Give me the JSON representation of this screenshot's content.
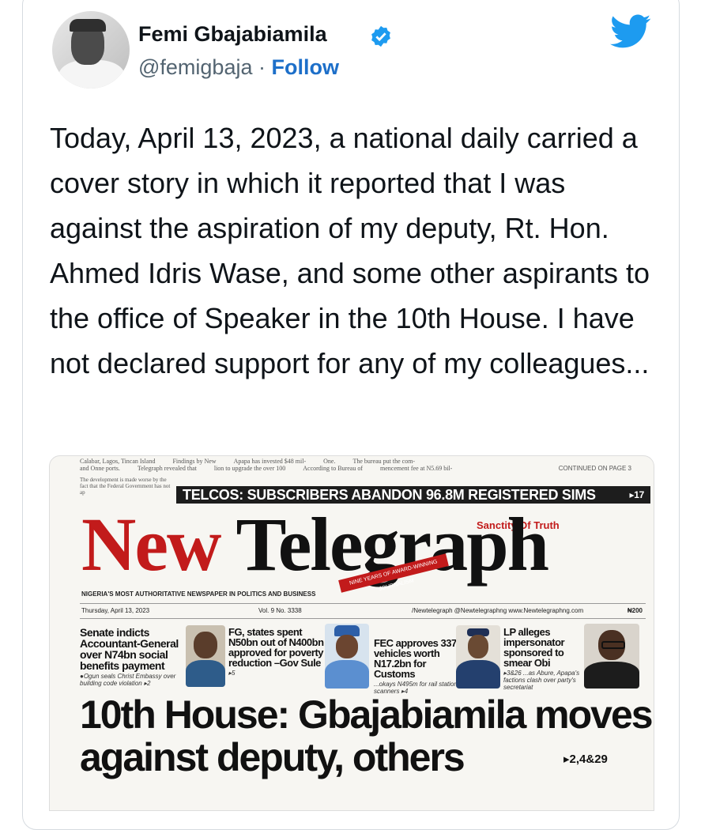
{
  "author": {
    "name": "Femi Gbajabiamila",
    "handle": "@femigbaja",
    "separator": "·",
    "follow_label": "Follow",
    "accent": "#1d9bf0"
  },
  "icons": [
    "verified-badge-icon",
    "twitter-bird-icon"
  ],
  "tweet": {
    "text": "Today, April 13, 2023, a national daily carried a cover story in which it reported that I was against the aspiration of my deputy, Rt. Hon. Ahmed Idris Wase, and some other aspirants to the office of Speaker in the 10th House.  I have not declared support for any of my colleagues..."
  },
  "newspaper": {
    "top_strip": "TELCOS: SUBSCRIBERS ABANDON 96.8M REGISTERED SIMS",
    "top_strip_page": "▸17",
    "continued": "CONTINUED ON PAGE 3",
    "masthead_new": "New",
    "masthead_telegraph": "Telegraph",
    "sanctity": "Sanctity Of Truth",
    "ribbon": "NINE YEARS OF AWARD-WINNING JOURNALISM",
    "tagline": "NIGERIA'S MOST AUTHORITATIVE NEWSPAPER IN POLITICS AND BUSINESS",
    "date": "Thursday, April 13, 2023",
    "volume": "Vol. 9 No. 3338",
    "social": "/Newtelegraph  @Newtelegraphng  www.Newtelegraphng.com",
    "price": "₦200",
    "stories": [
      {
        "headline": "Senate indicts Accountant-General over N74bn social benefits payment",
        "sub": "●Ogun seals Christ Embassy over building code violation ▸2"
      },
      {
        "headline": "FG, states spent N50bn out of N400bn approved for poverty reduction –Gov Sule",
        "sub": "▸5"
      },
      {
        "headline": "FEC approves 337 vehicles worth N17.2bn for Customs",
        "sub": "...okays N495m for rail stations scanners ▸4"
      },
      {
        "headline": "LP alleges impersonator sponsored to smear Obi",
        "sub": "▸3&26 ...as Abure, Apapa's factions clash over party's secretariat"
      }
    ],
    "lead_line1": "10th House: Gbajabiamila moves",
    "lead_line2": "against deputy, others",
    "lead_ref": "▸2,4&29"
  }
}
